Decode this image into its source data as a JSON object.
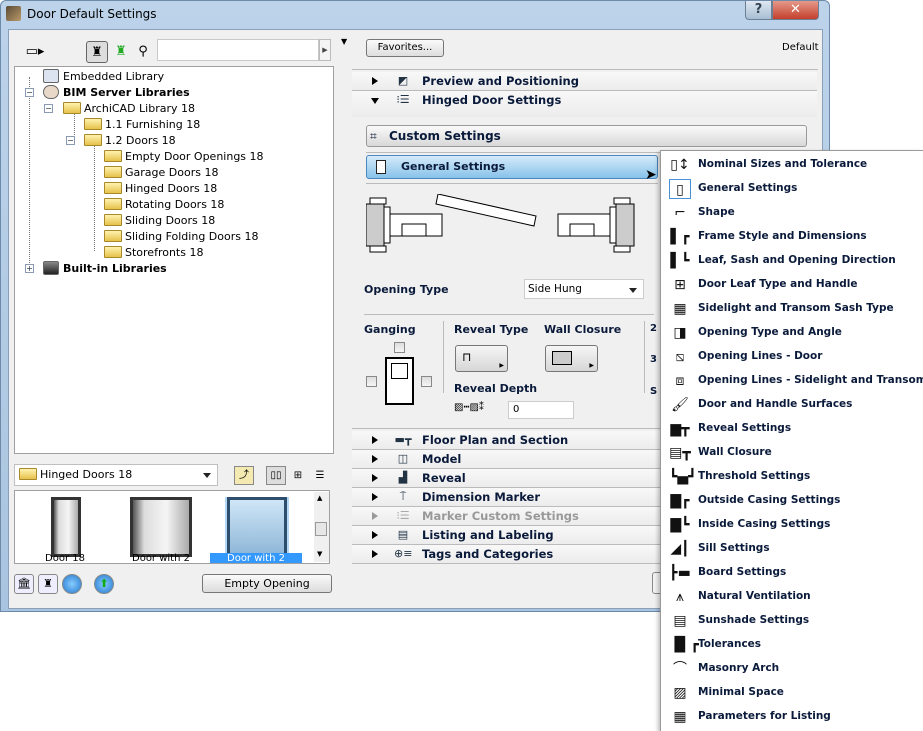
{
  "window": {
    "title": "Door Default Settings",
    "help": "?",
    "close": "✕"
  },
  "left": {
    "search_value": "",
    "tree": [
      {
        "label": "Embedded Library",
        "bold": false
      },
      {
        "label": "BIM Server Libraries",
        "bold": true
      },
      {
        "label": "ArchiCAD Library 18",
        "bold": false
      },
      {
        "label": "1.1 Furnishing 18",
        "bold": false
      },
      {
        "label": "1.2 Doors 18",
        "bold": false
      },
      {
        "label": "Empty Door Openings 18",
        "bold": false
      },
      {
        "label": "Garage Doors 18",
        "bold": false
      },
      {
        "label": "Hinged Doors 18",
        "bold": false
      },
      {
        "label": "Rotating Doors 18",
        "bold": false
      },
      {
        "label": "Sliding Doors 18",
        "bold": false
      },
      {
        "label": "Sliding Folding Doors 18",
        "bold": false
      },
      {
        "label": "Storefronts 18",
        "bold": false
      },
      {
        "label": "Built-in Libraries",
        "bold": true
      }
    ],
    "folder_select": "Hinged Doors 18",
    "thumbnails": [
      {
        "label": "Door 18",
        "selected": false
      },
      {
        "label": "Door with 2",
        "selected": false
      },
      {
        "label": "Door with 2",
        "selected": true
      }
    ],
    "empty_opening": "Empty Opening"
  },
  "right": {
    "favorites": "Favorites...",
    "default": "Default",
    "sections_top": [
      {
        "label": "Preview and Positioning",
        "expanded": false
      },
      {
        "label": "Hinged Door Settings",
        "expanded": true
      }
    ],
    "custom_settings": "Custom Settings",
    "general_settings": "General Settings",
    "opening_type_label": "Opening Type",
    "opening_type_value": "Side Hung",
    "ganging": "Ganging",
    "reveal_type": "Reveal Type",
    "wall_closure": "Wall Closure",
    "reveal_depth": "Reveal Depth",
    "reveal_depth_value": "0",
    "cut_labels": [
      "2",
      "3",
      "S"
    ],
    "sections_bottom": [
      {
        "label": "Floor Plan and Section",
        "disabled": false
      },
      {
        "label": "Model",
        "disabled": false
      },
      {
        "label": "Reveal",
        "disabled": false
      },
      {
        "label": "Dimension Marker",
        "disabled": false
      },
      {
        "label": "Marker Custom Settings",
        "disabled": true
      },
      {
        "label": "Listing and Labeling",
        "disabled": false
      },
      {
        "label": "Tags and Categories",
        "disabled": false
      }
    ]
  },
  "menu": {
    "selected": "General Settings",
    "items": [
      {
        "label": "Nominal Sizes and Tolerance",
        "icon": "nominal-sizes-icon"
      },
      {
        "label": "General Settings",
        "icon": "door-icon"
      },
      {
        "label": "Shape",
        "icon": "shape-icon"
      },
      {
        "label": "Frame Style and Dimensions",
        "icon": "frame-icon"
      },
      {
        "label": "Leaf, Sash and Opening Direction",
        "icon": "leaf-icon"
      },
      {
        "label": "Door Leaf Type and Handle",
        "icon": "door-leaf-icon"
      },
      {
        "label": "Sidelight and Transom Sash Type",
        "icon": "sash-icon"
      },
      {
        "label": "Opening Type and Angle",
        "icon": "opening-angle-icon"
      },
      {
        "label": "Opening Lines - Door",
        "icon": "opening-lines-icon"
      },
      {
        "label": "Opening Lines - Sidelight and Transom",
        "icon": "opening-lines-sidelight-icon"
      },
      {
        "label": "Door and Handle Surfaces",
        "icon": "brush-icon"
      },
      {
        "label": "Reveal Settings",
        "icon": "reveal-icon"
      },
      {
        "label": "Wall Closure",
        "icon": "wall-closure-icon"
      },
      {
        "label": "Threshold Settings",
        "icon": "threshold-icon"
      },
      {
        "label": "Outside Casing Settings",
        "icon": "outside-casing-icon"
      },
      {
        "label": "Inside Casing Settings",
        "icon": "inside-casing-icon"
      },
      {
        "label": "Sill Settings",
        "icon": "sill-icon"
      },
      {
        "label": "Board Settings",
        "icon": "board-icon"
      },
      {
        "label": "Natural Ventilation",
        "icon": "ventilation-icon"
      },
      {
        "label": "Sunshade Settings",
        "icon": "sunshade-icon"
      },
      {
        "label": "Tolerances",
        "icon": "tolerances-icon"
      },
      {
        "label": "Masonry Arch",
        "icon": "arch-icon"
      },
      {
        "label": "Minimal Space",
        "icon": "minimal-space-icon"
      },
      {
        "label": "Parameters for Listing",
        "icon": "listing-icon"
      }
    ]
  },
  "colors": {
    "selection": "#3399ff",
    "general_button": "#88c2ea",
    "title_bar": "#bcd3ea",
    "close_button": "#c4402c"
  }
}
